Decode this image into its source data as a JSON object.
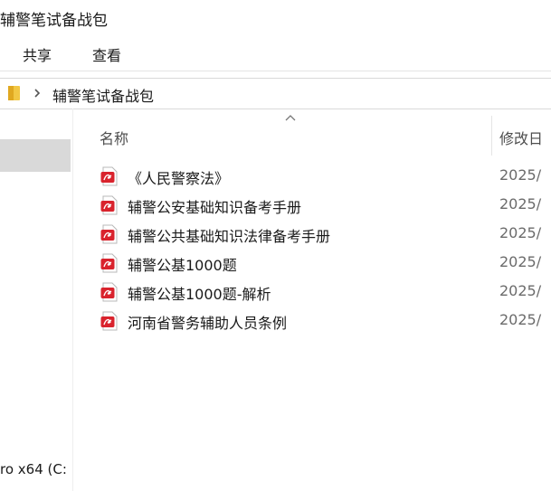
{
  "window": {
    "title": "辅警笔试备战包"
  },
  "ribbon": {
    "tabs": [
      {
        "label": "共享"
      },
      {
        "label": "查看"
      }
    ]
  },
  "address_bar": {
    "breadcrumb": "辅警笔试备战包",
    "icons": [
      "folder-icon",
      "chevron-right-icon"
    ]
  },
  "nav_pane": {
    "drive_label": "ro x64 (C:"
  },
  "columns": {
    "name": "名称",
    "modified": "修改日"
  },
  "files": [
    {
      "name": "《人民警察法》",
      "date": "2025/",
      "icon": "pdf-icon"
    },
    {
      "name": "辅警公安基础知识备考手册",
      "date": "2025/",
      "icon": "pdf-icon"
    },
    {
      "name": "辅警公共基础知识法律备考手册",
      "date": "2025/",
      "icon": "pdf-icon"
    },
    {
      "name": "辅警公基1000题",
      "date": "2025/",
      "icon": "pdf-icon"
    },
    {
      "name": "辅警公基1000题-解析",
      "date": "2025/",
      "icon": "pdf-icon"
    },
    {
      "name": "河南省警务辅助人员条例",
      "date": "2025/",
      "icon": "pdf-icon"
    }
  ],
  "colors": {
    "pdf_red": "#d9232d",
    "folder_yellow": "#f2c744",
    "nav_selected_bg": "#d9d9d9"
  }
}
